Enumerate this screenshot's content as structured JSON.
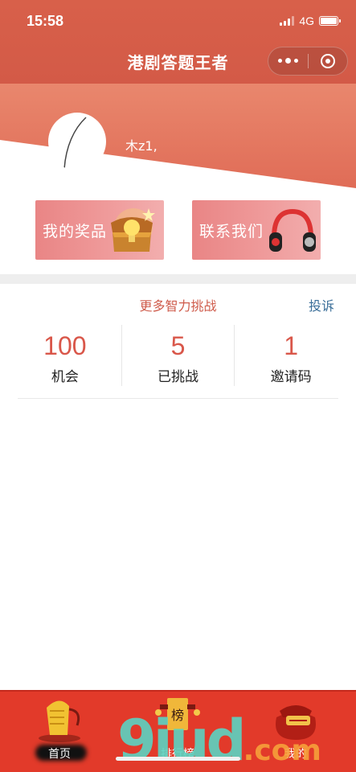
{
  "status_bar": {
    "time": "15:58",
    "network": "4G"
  },
  "nav": {
    "title": "港剧答题王者"
  },
  "profile": {
    "username": "木z1,"
  },
  "actions": [
    {
      "label": "我的奖品"
    },
    {
      "label": "联系我们"
    }
  ],
  "challenge": {
    "header": "更多智力挑战",
    "complain_label": "投诉",
    "stats": [
      {
        "value": "100",
        "label": "机会"
      },
      {
        "value": "5",
        "label": "已挑战"
      },
      {
        "value": "1",
        "label": "邀请码"
      }
    ]
  },
  "tabbar": {
    "tabs": [
      {
        "label": "首页"
      },
      {
        "label": "排行榜",
        "badge": "榜"
      },
      {
        "label": "我的"
      }
    ]
  },
  "watermark": {
    "text": "9iud",
    "suffix": ".com"
  },
  "colors": {
    "brand_red": "#d35a47",
    "accent_red": "#d9574a",
    "link_blue": "#3a6e99",
    "tab_bg": "#e23a2a"
  }
}
